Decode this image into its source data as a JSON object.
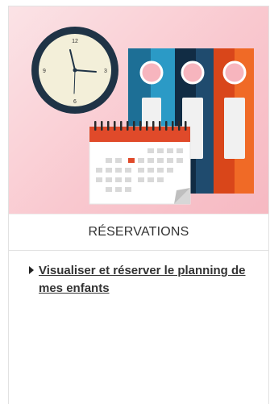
{
  "card": {
    "title": "RÉSERVATIONS",
    "links": [
      {
        "label": "Visualiser et réserver le planning de mes enfants"
      }
    ]
  },
  "illustration": {
    "clock_numbers": [
      "12",
      "3",
      "6",
      "9"
    ],
    "icons": [
      "clock-icon",
      "binders-icon",
      "calendar-icon"
    ]
  },
  "colors": {
    "hero_background": "#f9c8cf",
    "clock_rim": "#1f3346",
    "binder_blue": "#2b8fb8",
    "binder_navy": "#1a3a55",
    "binder_orange": "#e85a1e",
    "calendar_red": "#e04a2a"
  }
}
